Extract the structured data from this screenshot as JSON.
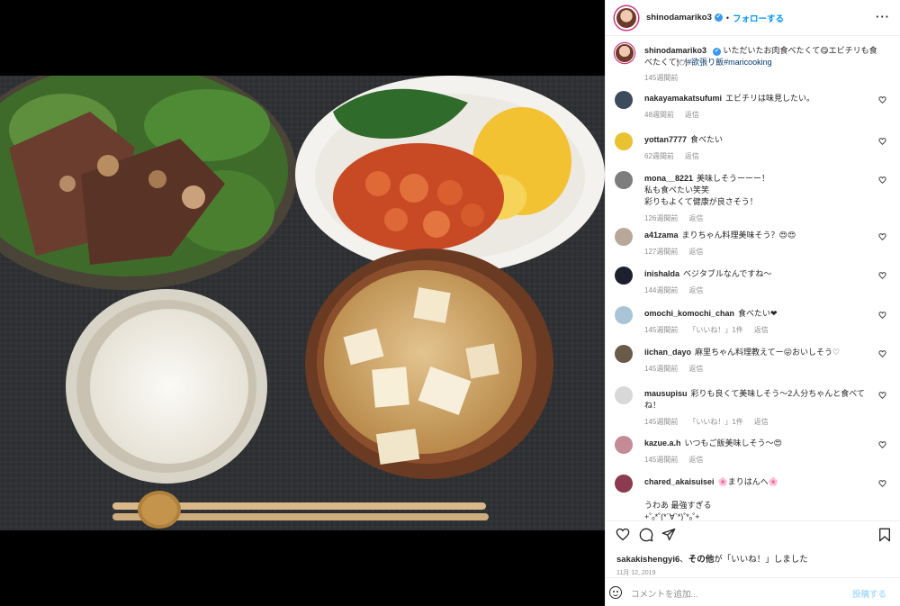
{
  "header": {
    "username": "shinodamariko3",
    "separator": "•",
    "follow_label": "フォローする",
    "more_label": "···"
  },
  "caption": {
    "username": "shinodamariko3",
    "text": "いただいたお肉食べたくて😋エビチリも食べたくて🍽",
    "hashtags": "#欲張り飯#maricooking",
    "time": "145週間前"
  },
  "comments": [
    {
      "user": "nakayamakatsufumi",
      "text": "エビチリは味見したい。",
      "time": "48週間前",
      "reply": "返信",
      "likes": "",
      "avatar_color": "#3b4a5c"
    },
    {
      "user": "yottan7777",
      "text": "食べたい",
      "time": "62週間前",
      "reply": "返信",
      "likes": "",
      "avatar_color": "#e8c231"
    },
    {
      "user": "mona__8221",
      "text": "美味しそうーーー！\n私も食べたい笑笑\n彩りもよくて健康が良さそう！",
      "time": "126週間前",
      "reply": "返信",
      "likes": "",
      "avatar_color": "#7d7d7d"
    },
    {
      "user": "a41zama",
      "text": "まりちゃん料理美味そう？😍😍",
      "time": "127週間前",
      "reply": "返信",
      "likes": "",
      "avatar_color": "#b9a89a"
    },
    {
      "user": "inishalda",
      "text": "ベジタブルなんですね〜",
      "time": "144週間前",
      "reply": "返信",
      "likes": "",
      "avatar_color": "#1d1f2e"
    },
    {
      "user": "omochi_komochi_chan",
      "text": "食べたい❤",
      "time": "145週間前",
      "reply": "返信",
      "likes": "「いいね！」1件",
      "avatar_color": "#a9c4d6"
    },
    {
      "user": "iichan_dayo",
      "text": "麻里ちゃん料理教えてー😛おいしそう♡",
      "time": "145週間前",
      "reply": "返信",
      "likes": "",
      "avatar_color": "#6a5a4a"
    },
    {
      "user": "mausupisu",
      "text": "彩りも良くて美味しそう〜2人分ちゃんと食べてね！",
      "time": "145週間前",
      "reply": "返信",
      "likes": "「いいね！」1件",
      "avatar_color": "#d8d8d8"
    },
    {
      "user": "kazue.a.h",
      "text": "いつもご飯美味しそう〜😍",
      "time": "145週間前",
      "reply": "返信",
      "likes": "",
      "avatar_color": "#c48b96"
    },
    {
      "user": "chared_akaisuisei",
      "text": "🌸まりはんへ🌸\n\nうわあ 最強すぎる\n+˚ₒ*˚(*´∀`*)˚*ₒ˚+",
      "time": "",
      "reply": "",
      "likes": "",
      "avatar_color": "#8b3a50"
    }
  ],
  "actions": {
    "liked_by_user": "sakakishengyi6",
    "liked_rest": "その他",
    "liked_suffix": "が「いいね！」しました",
    "date": "11月 12, 2019",
    "add_comment_placeholder": "コメントを追加...",
    "post_label": "投稿する"
  },
  "icons": [
    "heart-icon",
    "comment-icon",
    "share-icon",
    "bookmark-icon",
    "emoji-icon",
    "more-icon",
    "verified-icon"
  ]
}
